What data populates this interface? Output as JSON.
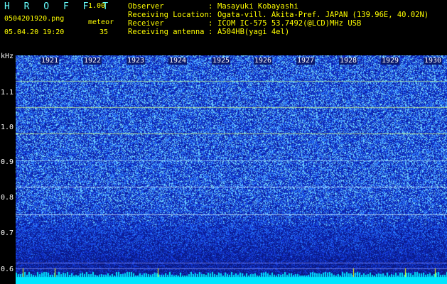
{
  "app": {
    "title": "H R O F F T",
    "version": "1.00"
  },
  "file": {
    "name": "0504201920.png",
    "datetime": "05.04.20 19:20"
  },
  "meteor": {
    "label": "meteor",
    "count": "35"
  },
  "info": [
    {
      "label": "Observer",
      "sep": ":",
      "value": "Masayuki Kobayashi"
    },
    {
      "label": "Receiving Location",
      "sep": ":",
      "value": "Ogata-vill. Akita-Pref. JAPAN (139.96E, 40.02N)"
    },
    {
      "label": "Receiver",
      "sep": ":",
      "value": "ICOM IC-575 53.7492(@LCD)MHz USB"
    },
    {
      "label": "Receiving antenna",
      "sep": ":",
      "value": "A504HB(yagi 4el)"
    }
  ],
  "freq_axis": {
    "unit": "kHz",
    "ticks": [
      "1.1",
      "1.0",
      "0.9",
      "0.8",
      "0.7",
      "0.6"
    ]
  },
  "time_axis": {
    "ticks": [
      "1921",
      "1922",
      "1923",
      "1924",
      "1925",
      "1926",
      "1927",
      "1928",
      "1929",
      "1930"
    ]
  },
  "colors": {
    "accent": "#66ffff",
    "text": "#ffffff",
    "version": "#ffff00",
    "bg": "#000000"
  }
}
